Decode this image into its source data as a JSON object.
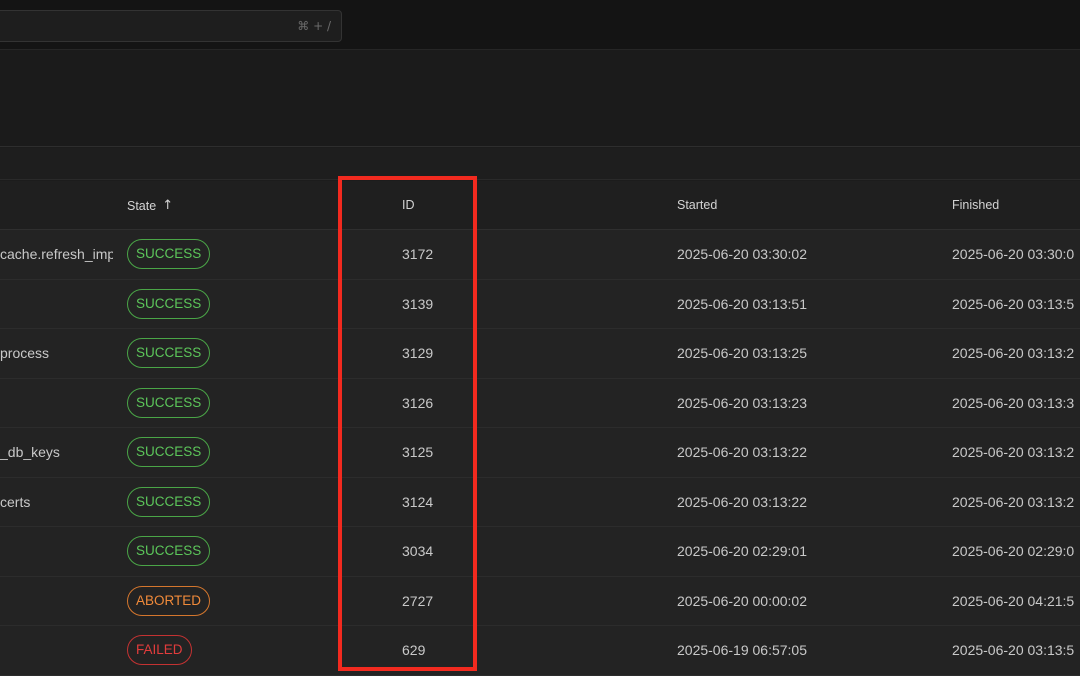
{
  "search": {
    "placeholder": "",
    "shortcut": "⌘ + /"
  },
  "table": {
    "columns": {
      "state": "State",
      "id": "ID",
      "started": "Started",
      "finished": "Finished"
    },
    "sort_icon": "arrow-up-icon",
    "rows": [
      {
        "name": "cache.refresh_imp",
        "state": "SUCCESS",
        "state_kind": "success",
        "id": "3172",
        "started": "2025-06-20 03:30:02",
        "finished": "2025-06-20 03:30:0"
      },
      {
        "name": "",
        "state": "SUCCESS",
        "state_kind": "success",
        "id": "3139",
        "started": "2025-06-20 03:13:51",
        "finished": "2025-06-20 03:13:5"
      },
      {
        "name": "process",
        "state": "SUCCESS",
        "state_kind": "success",
        "id": "3129",
        "started": "2025-06-20 03:13:25",
        "finished": "2025-06-20 03:13:2"
      },
      {
        "name": "",
        "state": "SUCCESS",
        "state_kind": "success",
        "id": "3126",
        "started": "2025-06-20 03:13:23",
        "finished": "2025-06-20 03:13:3"
      },
      {
        "name": "_db_keys",
        "state": "SUCCESS",
        "state_kind": "success",
        "id": "3125",
        "started": "2025-06-20 03:13:22",
        "finished": "2025-06-20 03:13:2"
      },
      {
        "name": "certs",
        "state": "SUCCESS",
        "state_kind": "success",
        "id": "3124",
        "started": "2025-06-20 03:13:22",
        "finished": "2025-06-20 03:13:2"
      },
      {
        "name": "",
        "state": "SUCCESS",
        "state_kind": "success",
        "id": "3034",
        "started": "2025-06-20 02:29:01",
        "finished": "2025-06-20 02:29:0"
      },
      {
        "name": "",
        "state": "ABORTED",
        "state_kind": "aborted",
        "id": "2727",
        "started": "2025-06-20 00:00:02",
        "finished": "2025-06-20 04:21:5"
      },
      {
        "name": "",
        "state": "FAILED",
        "state_kind": "failed",
        "id": "629",
        "started": "2025-06-19 06:57:05",
        "finished": "2025-06-20 03:13:5"
      }
    ]
  },
  "colors": {
    "highlight": "#f22a1f",
    "success": "#5cc65a",
    "aborted": "#f08a3a",
    "failed": "#e23c3c"
  }
}
